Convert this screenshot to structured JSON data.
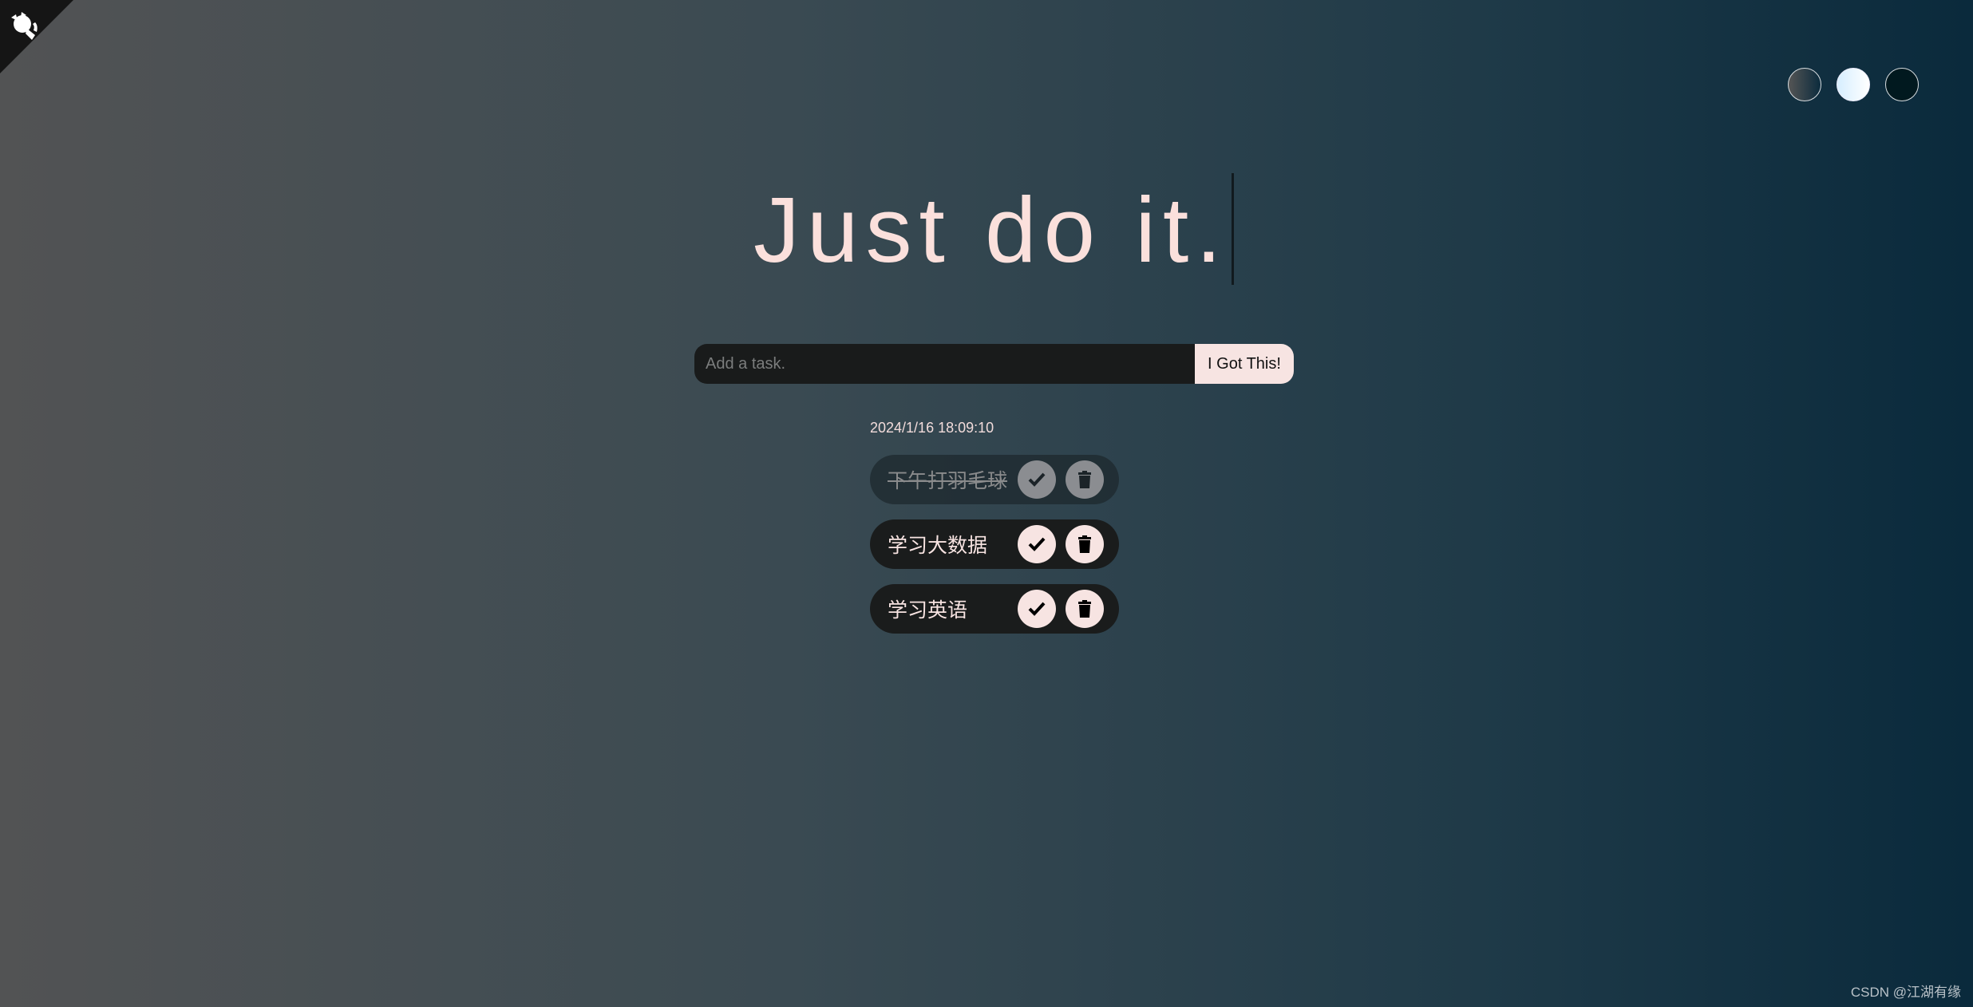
{
  "header": {
    "title": "Just do it."
  },
  "themes": [
    {
      "name": "standard",
      "colors": [
        "#555555",
        "#0b2b3d"
      ]
    },
    {
      "name": "light",
      "colors": [
        "#d6eeff",
        "#ffffff"
      ]
    },
    {
      "name": "darker",
      "colors": [
        "#01191f"
      ]
    }
  ],
  "form": {
    "placeholder": "Add a task.",
    "value": "",
    "submit_label": "I Got This!"
  },
  "datetime": "2024/1/16 18:09:10",
  "todos": [
    {
      "text": "下午打羽毛球",
      "completed": true
    },
    {
      "text": "学习大数据",
      "completed": false
    },
    {
      "text": "学习英语",
      "completed": false
    }
  ],
  "icons": {
    "corner": "github-icon",
    "check": "check-icon",
    "delete": "trash-icon"
  },
  "watermark": "CSDN @江湖有缘"
}
